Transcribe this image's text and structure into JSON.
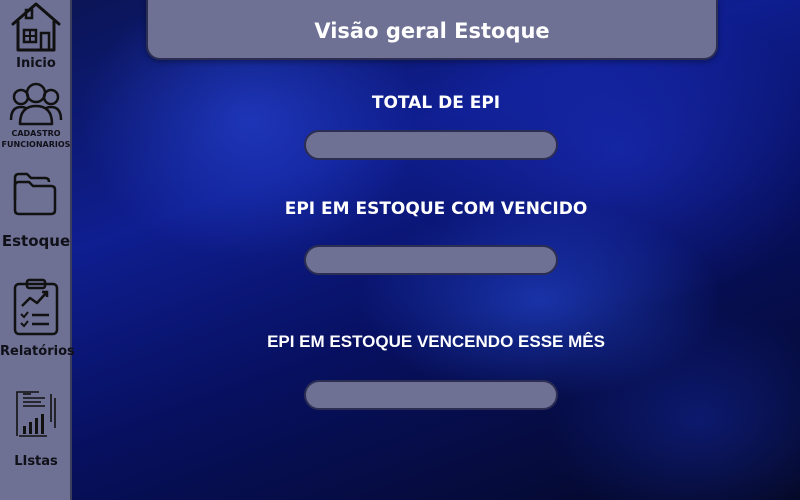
{
  "header": {
    "title": "Visão geral Estoque"
  },
  "sidebar": {
    "items": [
      {
        "label": "Inicio",
        "icon": "house-icon"
      },
      {
        "label": "CADASTRO FUNCIONARIOS",
        "icon": "users-icon"
      },
      {
        "label": "Estoque",
        "icon": "folders-icon"
      },
      {
        "label": "Relatórios",
        "icon": "clipboard-chart-icon"
      },
      {
        "label": "LIstas",
        "icon": "document-chart-icon"
      }
    ]
  },
  "stats": {
    "total_epi": {
      "label": "TOTAL DE EPI",
      "value": ""
    },
    "epi_vencido": {
      "label": "EPI EM ESTOQUE COM VENCIDO",
      "value": ""
    },
    "epi_vencendo_mes": {
      "label": "EPI EM ESTOQUE VENCENDO ESSE MÊS",
      "value": ""
    }
  },
  "colors": {
    "panel": "#6e7094",
    "panel_border": "#2b2d52",
    "background_primary": "#0f1e90",
    "background_dark": "#040824",
    "text": "#ffffff",
    "sidebar_text": "#101018"
  }
}
